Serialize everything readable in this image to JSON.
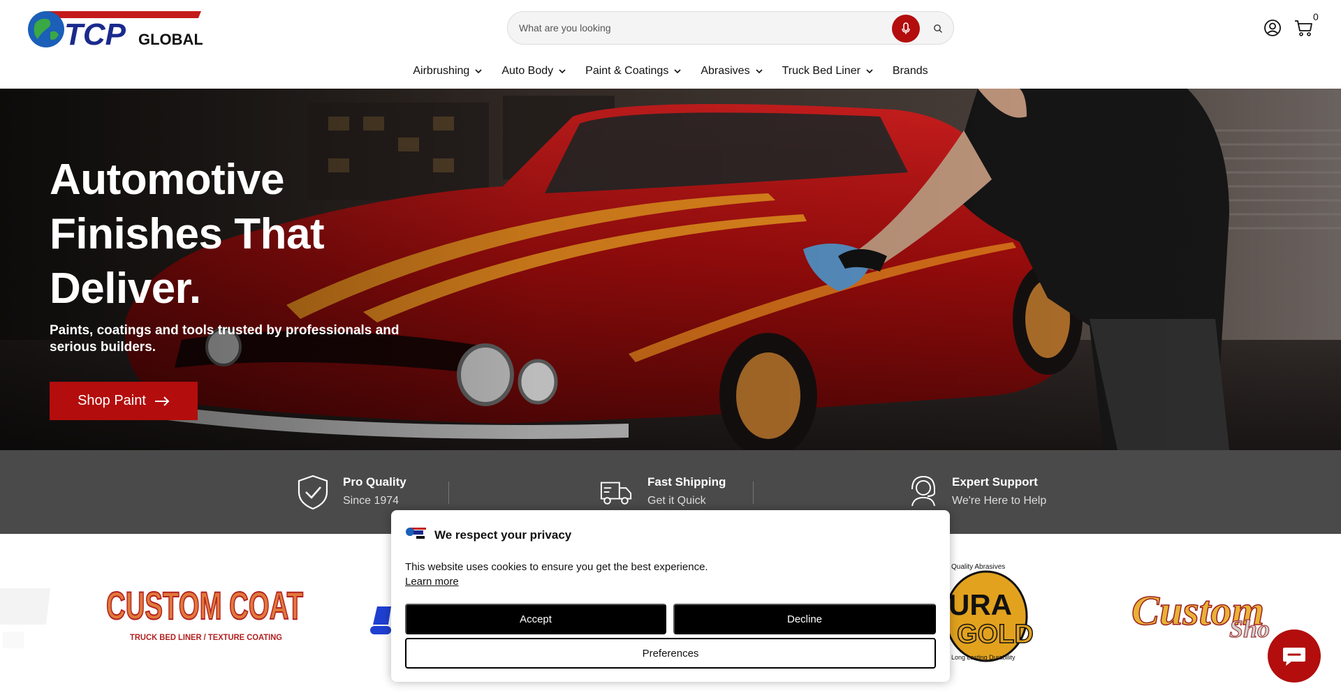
{
  "brand": {
    "name_tcp": "TCP",
    "name_global": "GLOBAL"
  },
  "search": {
    "placeholder": "What are you looking"
  },
  "cart": {
    "count": "0"
  },
  "nav": [
    {
      "label": "Airbrushing"
    },
    {
      "label": "Auto Body"
    },
    {
      "label": "Paint & Coatings"
    },
    {
      "label": "Abrasives"
    },
    {
      "label": "Truck Bed Liner"
    },
    {
      "label": "Brands"
    }
  ],
  "hero": {
    "title_line1": "Automotive",
    "title_line2": "Finishes That",
    "title_line3": "Deliver.",
    "subtitle": "Paints, coatings and tools trusted by professionals and serious builders.",
    "cta_label": "Shop Paint"
  },
  "features": [
    {
      "title": "Pro Quality",
      "subtitle": "Since 1974"
    },
    {
      "title": "Fast Shipping",
      "subtitle": "Get it Quick"
    },
    {
      "title": "Expert Support",
      "subtitle": "We're Here to Help"
    }
  ],
  "brands": {
    "custom_coat": "CUSTOM COAT",
    "custom_coat_tagline": "TRUCK BED LINER / TEXTURE COATING",
    "dura_gold_top": "Quality Abrasives",
    "dura_gold_name1": "URA",
    "dura_gold_name2": "GOLD",
    "dura_gold_bottom": "Long Lasting Durability",
    "custom_shop1": "Custom",
    "custom_shop2": "Sho"
  },
  "cookie": {
    "title": "We respect your privacy",
    "text": "This website uses cookies to ensure you get the best experience.",
    "link": "Learn more",
    "accept": "Accept",
    "decline": "Decline",
    "preferences": "Preferences"
  },
  "colors": {
    "accent": "#b30d0d",
    "band": "#4a4a4a",
    "navy": "#1a2a8c"
  },
  "icons": {
    "mic": "microphone-icon",
    "search": "search-icon",
    "account": "user-circle-icon",
    "cart": "cart-icon",
    "chevron": "chevron-down-icon",
    "arrow": "arrow-right-icon",
    "shield": "shield-check-icon",
    "truck": "truck-icon",
    "support": "headset-icon",
    "chat": "chat-bubble-icon"
  }
}
